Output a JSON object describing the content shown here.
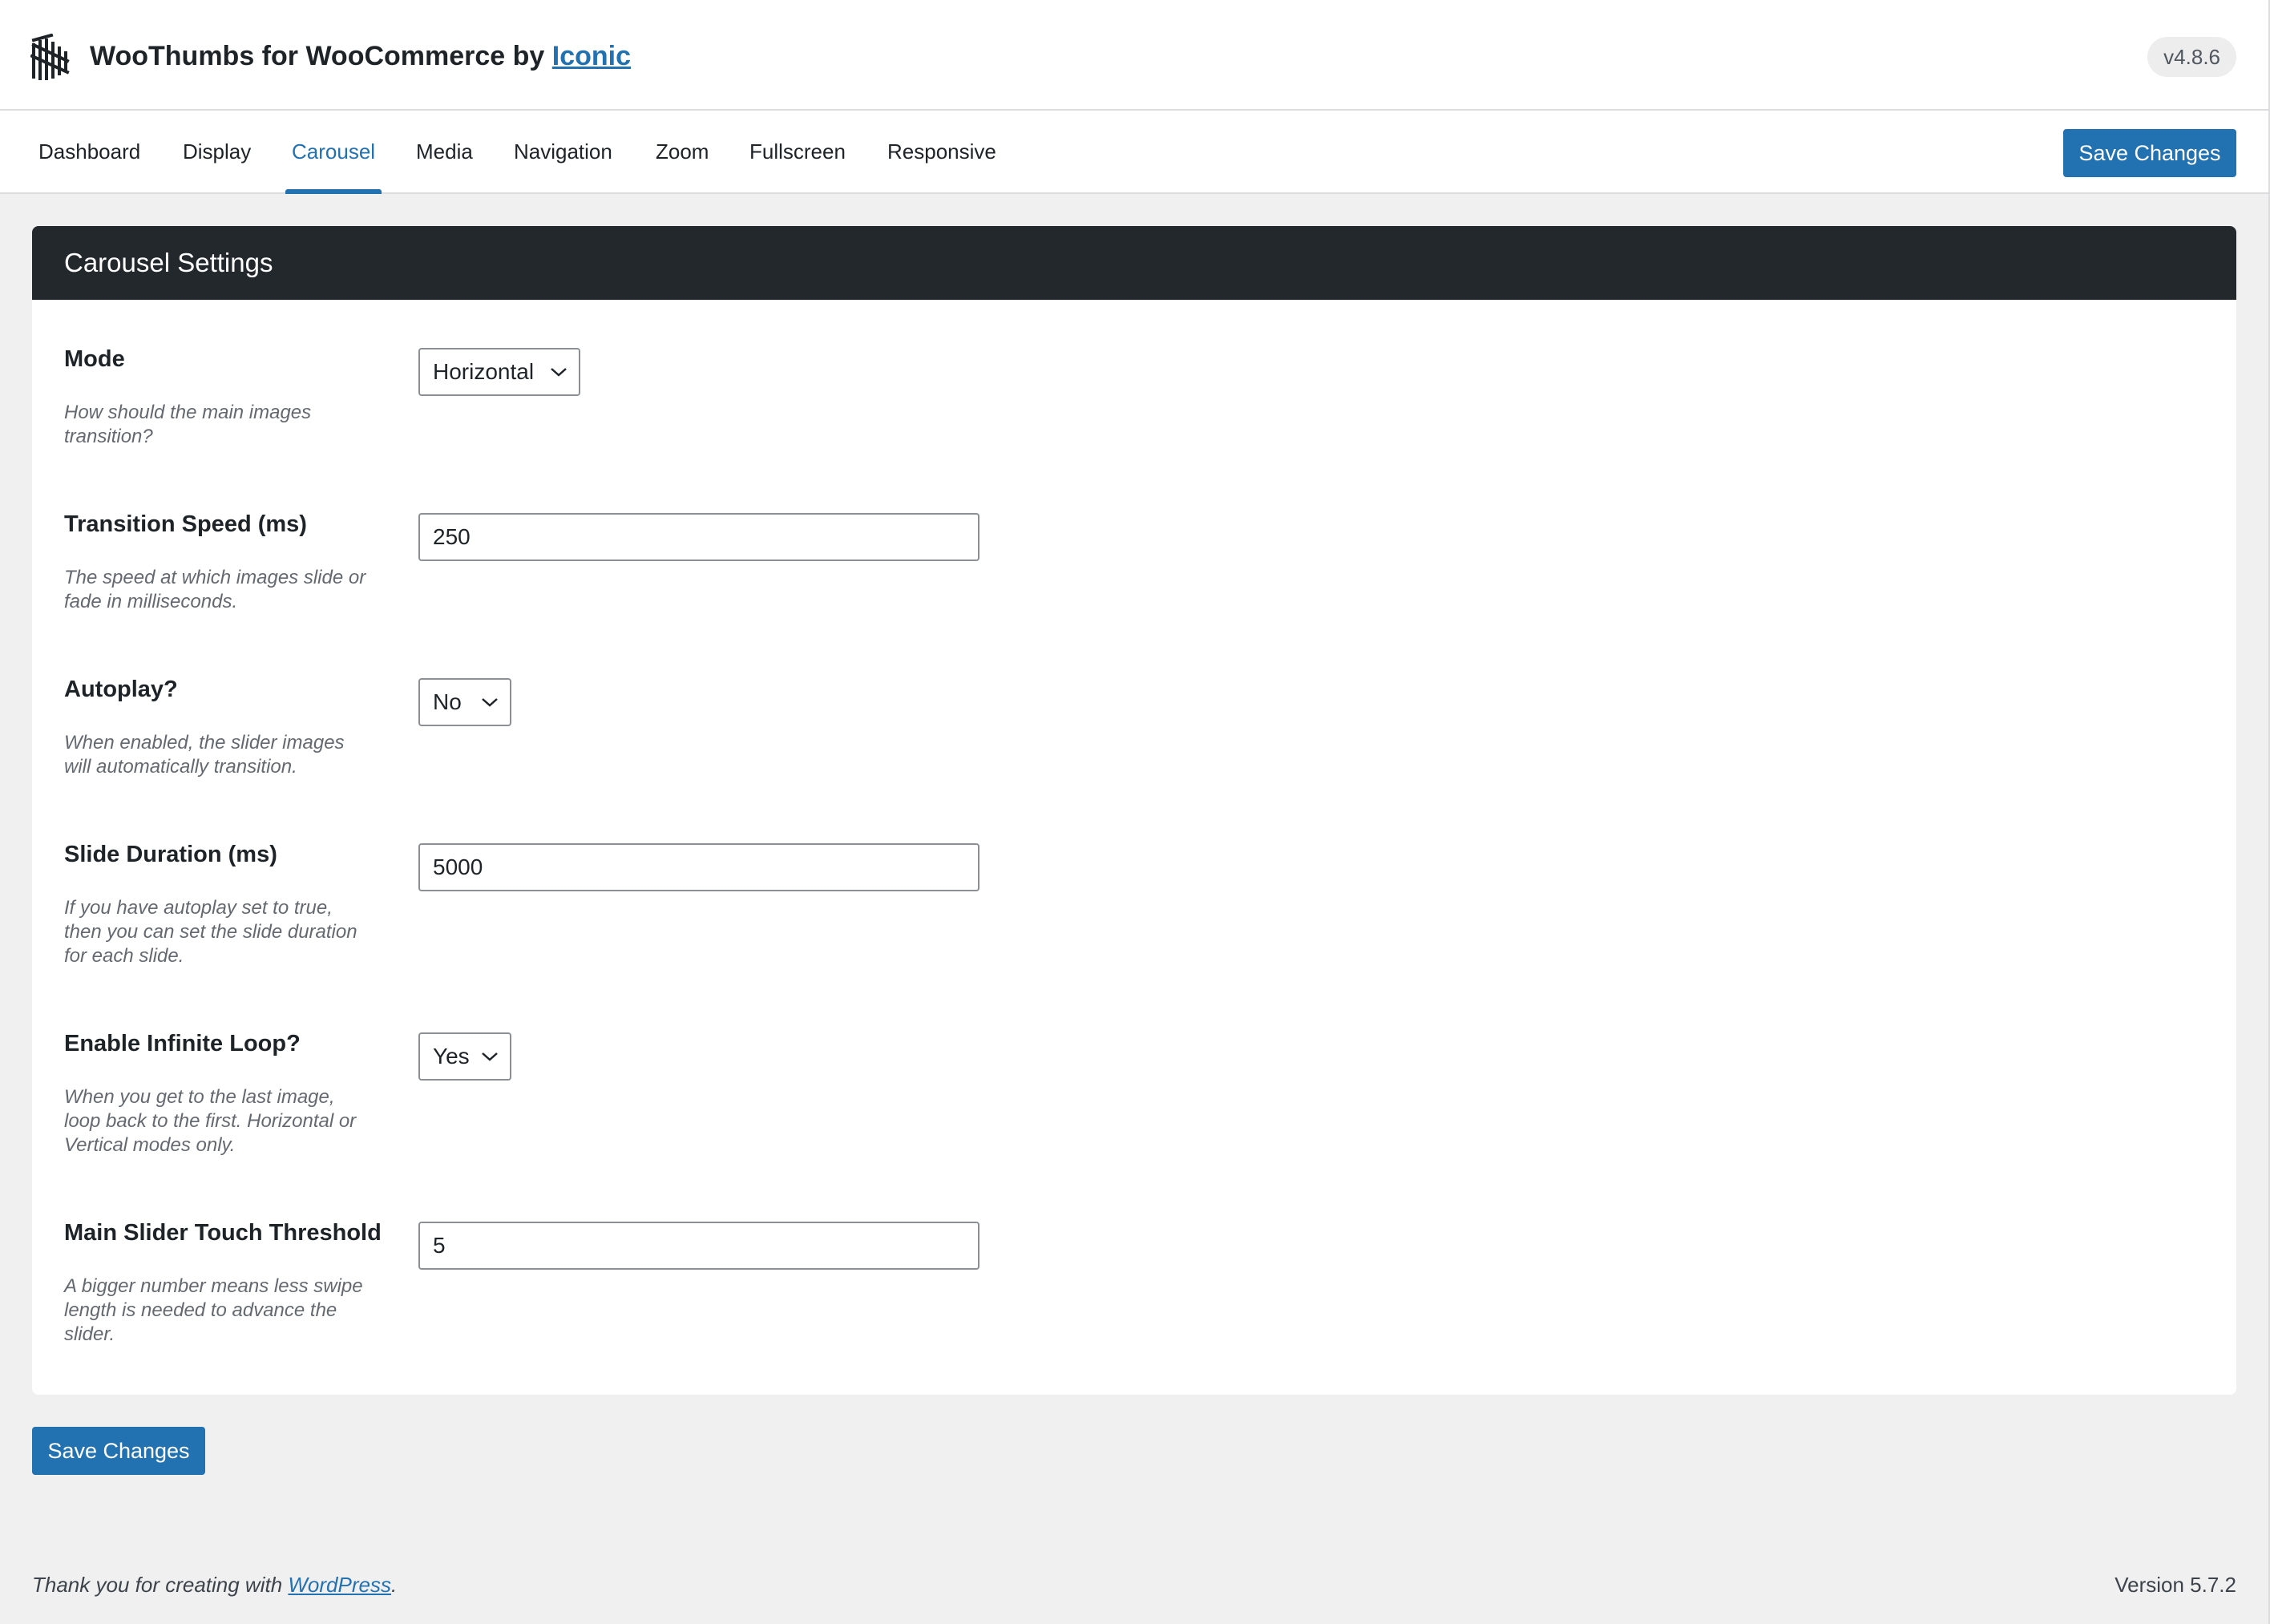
{
  "header": {
    "title_prefix": "WooThumbs for WooCommerce by",
    "title_link": "Iconic",
    "version": "v4.8.6",
    "logo_icon": "iconic-logo-icon"
  },
  "tabs": [
    {
      "label": "Dashboard",
      "active": false
    },
    {
      "label": "Display",
      "active": false
    },
    {
      "label": "Carousel",
      "active": true
    },
    {
      "label": "Media",
      "active": false
    },
    {
      "label": "Navigation",
      "active": false
    },
    {
      "label": "Zoom",
      "active": false
    },
    {
      "label": "Fullscreen",
      "active": false
    },
    {
      "label": "Responsive",
      "active": false
    }
  ],
  "actions": {
    "save_label": "Save Changes"
  },
  "panel": {
    "title": "Carousel Settings",
    "fields": [
      {
        "label": "Mode",
        "desc_lines": [
          "How should the main images",
          "transition?"
        ],
        "control": "select",
        "value": "Horizontal"
      },
      {
        "label": "Transition Speed (ms)",
        "desc_lines": [
          "The speed at which images slide or",
          "fade in milliseconds."
        ],
        "control": "text",
        "value": "250"
      },
      {
        "label": "Autoplay?",
        "desc_lines": [
          "When enabled, the slider images",
          "will automatically transition."
        ],
        "control": "select",
        "value": "No"
      },
      {
        "label": "Slide Duration (ms)",
        "desc_lines": [
          "If you have autoplay set to true,",
          "then you can set the slide duration",
          "for each slide."
        ],
        "control": "text",
        "value": "5000"
      },
      {
        "label": "Enable Infinite Loop?",
        "desc_lines": [
          "When you get to the last image,",
          "loop back to the first. Horizontal or",
          "Vertical modes only."
        ],
        "control": "select",
        "value": "Yes"
      },
      {
        "label": "Main Slider Touch Threshold",
        "desc_lines": [
          "A bigger number means less swipe",
          "length is needed to advance the",
          "slider."
        ],
        "control": "text",
        "value": "5"
      }
    ]
  },
  "footer": {
    "thanks_prefix": "Thank you for creating with",
    "thanks_link": "WordPress",
    "thanks_suffix": ".",
    "version": "Version 5.7.2"
  },
  "colors": {
    "accent": "#2271b1",
    "panel_header_bg": "#23282d",
    "page_bg": "#f0f0f1"
  }
}
